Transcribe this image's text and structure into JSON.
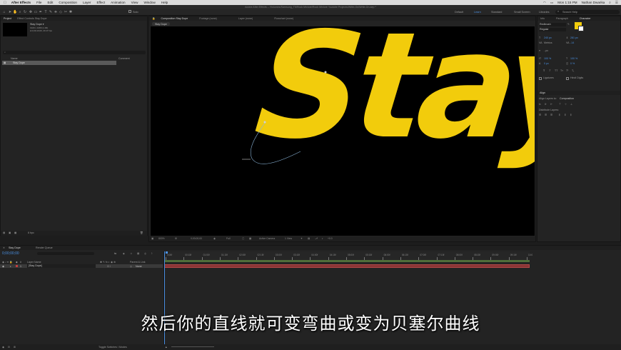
{
  "menubar": {
    "app": "After Effects",
    "items": [
      "File",
      "Edit",
      "Composition",
      "Layer",
      "Effect",
      "Animation",
      "View",
      "Window",
      "Help"
    ],
    "clock": "Mon 1:15 PM",
    "user": "Nathan Dwarika"
  },
  "titlebar": {
    "text": "Adobe After Effects – /Volumes/Samsung_T5/Rock Mixture/Rock Mixture Youtube Projects/Write-On/Write-On.aep *"
  },
  "toolbar": {
    "solo_label": "Solo",
    "workspaces": [
      "Default",
      "Learn",
      "Standard",
      "Small Screen",
      "Libraries"
    ],
    "search_placeholder": "Search Help"
  },
  "project_panel": {
    "tabs": [
      "Project",
      "Effect Controls Stay Dope"
    ],
    "item_name": "Stay Dope ▾",
    "item_info_1": "1920 x 1080 (1.00)",
    "item_info_2": "Δ 0;00;10;00, 29.97 fps",
    "col_name": "Name",
    "col_comment": "Comment",
    "rows": [
      "Stay Dope"
    ],
    "bpc": "8 bpc"
  },
  "composition_panel": {
    "tabs": [
      "Composition Stay Dope",
      "Footage (none)",
      "Layer (none)",
      "Flowchart (none)"
    ],
    "breadcrumb": "Stay Dope",
    "canvas_text": "Stay",
    "zoom": "800%",
    "timecode": "0;00;00;00",
    "resolution": "Full",
    "camera": "Active Camera",
    "view": "1 View",
    "exposure": "+0.0"
  },
  "right_panel": {
    "tabs": [
      "Info",
      "Paragraph",
      "Character"
    ],
    "font": "Redbrush",
    "style": "Regular",
    "size": "240 px",
    "leading": "281 px",
    "kerning": "Metrics",
    "tracking": "-14",
    "stroke": "- px",
    "vscale": "100 %",
    "hscale": "100 %",
    "baseline": "0 px",
    "tsume": "0 %",
    "ligatures": "Ligatures",
    "hindi": "Hindi Digits",
    "align_tab": "Align",
    "align_to_label": "Align Layers to:",
    "align_to_value": "Composition",
    "distribute": "Distribute Layers:",
    "color": "#f2cc0c"
  },
  "timeline": {
    "tabs": [
      "Stay Dope",
      "Render Queue"
    ],
    "timecode": "0;00;00;00",
    "col_layer": "Layer Name",
    "col_parent": "Parent & Link",
    "layer_index": "1",
    "layer_name": "[Stay Dope]",
    "parent_value": "None",
    "ruler": [
      "0;00f",
      "00:15f",
      "01:00f",
      "01:15f",
      "02:00f",
      "02:15f",
      "03:00f",
      "03:15f",
      "04:00f",
      "04:15f",
      "05:00f",
      "05:15f",
      "06:00f",
      "06:15f",
      "07:00f",
      "07:15f",
      "08:00f",
      "08:15f",
      "09:00f",
      "09:15f",
      "10:0"
    ],
    "toggle": "Toggle Switches / Modes"
  },
  "subtitle": "然后你的直线就可变弯曲或变为贝塞尔曲线"
}
